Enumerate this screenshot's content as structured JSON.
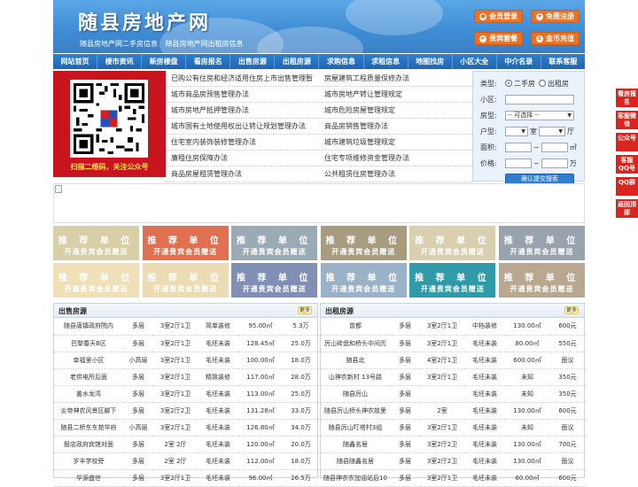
{
  "header": {
    "site_title": "随县房地产网",
    "subtitle_1": "随县房地产网二手房信息",
    "subtitle_2": "随县房地产网出租房信息",
    "buttons": [
      {
        "label": "会员登录",
        "icon": "user-icon"
      },
      {
        "label": "免费注册",
        "icon": "register-icon"
      },
      {
        "label": "贵宾套餐",
        "icon": "vip-icon"
      },
      {
        "label": "金币充值",
        "icon": "coin-icon"
      }
    ]
  },
  "nav": [
    "网站首页",
    "楼市资讯",
    "新房楼盘",
    "看房报名",
    "出售房源",
    "出租房源",
    "求购信息",
    "求租信息",
    "地图找房",
    "小区大全",
    "中介名录",
    "联系客服"
  ],
  "qr": {
    "caption": "扫描二维码，关注公众号"
  },
  "news": [
    [
      "已购公有住房和经济适用住房上市出售管理暂",
      "房屋建筑工程质量保修办法"
    ],
    [
      "城市商品房预售管理办法",
      "城市房地产转让管理规定"
    ],
    [
      "城市房地产抵押管理办法",
      "城市危险房屋管理规定"
    ],
    [
      "城市国有土地使用权出让转让规划管理办法",
      "商品房销售管理办法"
    ],
    [
      "住宅室内装饰装修管理办法",
      "城市建筑垃圾管理规定"
    ],
    [
      "廉租住房保障办法",
      "住宅专项维修资金管理办法"
    ],
    [
      "商品房屋租赁管理办法",
      "公共租赁住房管理办法"
    ]
  ],
  "search": {
    "type_label": "类型:",
    "type_options": [
      "二手房",
      "出租房"
    ],
    "type_selected": "二手房",
    "community_label": "小区:",
    "community_value": "",
    "house_type_label": "房型:",
    "house_type_value": "-- 可选择 --",
    "layout_label": "户型:",
    "room_unit": "室",
    "hall_unit": "厅",
    "area_label": "面积:",
    "area_unit": "㎡",
    "price_label": "价格:",
    "price_unit": "万",
    "range_sep": "~",
    "submit_label": "确认提交搜索"
  },
  "ads": {
    "line1": "推 荐 单 位",
    "line2": "开通贵宾会员赠送",
    "colors": [
      "#d8cfa8",
      "#e07050",
      "#9aabb6",
      "#a89c80",
      "#d9cfb0",
      "#98a3ad",
      "#efe0b8",
      "#ecdcb4",
      "#7f8fb5",
      "#9ab2c8",
      "#2f9aa8",
      "#b8a890"
    ]
  },
  "sale": {
    "title": "出售房源",
    "more": "更多",
    "rows": [
      [
        "随县唐镇政府院内",
        "多层",
        "3室2厅1卫",
        "简单装修",
        "95.00㎡",
        "5.3万"
      ],
      [
        "巴黎春天B区",
        "多层",
        "3室2厅1卫",
        "毛坯未装",
        "128.45㎡",
        "25.0万"
      ],
      [
        "幸福里小区",
        "小高层",
        "3室2厅1卫",
        "毛坯未装",
        "100.00㎡",
        "18.0万"
      ],
      [
        "老供电所后面",
        "多层",
        "3室2厅1卫",
        "精致装修",
        "117.00㎡",
        "28.0万"
      ],
      [
        "姜水龙湾",
        "多层",
        "3室2厅1卫",
        "毛坯未装",
        "113.00㎡",
        "25.0万"
      ],
      [
        "炎帝神农风景区脚下",
        "多层",
        "3室2厅2卫",
        "毛坯未装",
        "131.28㎡",
        "33.0万"
      ],
      [
        "随县二桥东东苑华府",
        "小高层",
        "3室2厅1卫",
        "毛坯未装",
        "126.80㎡",
        "34.0万"
      ],
      [
        "殷店政府宾馆对面",
        "多层",
        "2室 2厅",
        "毛坯未装",
        "120.00㎡",
        "20.0万"
      ],
      [
        "岁丰学校旁",
        "多层",
        "2室 2厅",
        "毛坯未装",
        "112.00㎡",
        "18.0万"
      ],
      [
        "华源盛世",
        "多层",
        "3室2厅1卫",
        "毛坯未装",
        "96.00㎡",
        "26.5万"
      ]
    ]
  },
  "rent": {
    "title": "出租房源",
    "more": "更多",
    "rows": [
      [
        "曾都",
        "多层",
        "3室2厅1卫",
        "中档装修",
        "130.00㎡",
        "600元"
      ],
      [
        "厉山砖盘和桥头中间历",
        "多层",
        "3室2厅1卫",
        "毛坯未装",
        "80.00㎡",
        "550元"
      ],
      [
        "随县北",
        "多层",
        "4室2厅1卫",
        "毛坯未装",
        "600.00㎡",
        "面议"
      ],
      [
        "山神农新村 13号路",
        "多层",
        "3室2厅1卫",
        "毛坯未装",
        "未知",
        "350元"
      ],
      [
        "随县厉山",
        "多层",
        "",
        "毛坯未装",
        "未知",
        "350元"
      ],
      [
        "随县厉山桥头神农故里",
        "多层",
        "2室",
        "毛坯未装",
        "130.00㎡",
        "600元"
      ],
      [
        "随县厉山叮塔村3组",
        "多层",
        "3室2厅1卫",
        "毛坯未装",
        "未知",
        "面议"
      ],
      [
        "随鑫名居",
        "多层",
        "3室2厅2卫",
        "毛坯未装",
        "130.00㎡",
        "700元"
      ],
      [
        "随县随鑫名居",
        "多层",
        "3室2厅2卫",
        "毛坯未装",
        "130.00㎡",
        "面议"
      ],
      [
        "随县神农农加油站后10",
        "多层",
        "3室2厅1卫",
        "毛坯未装",
        "60.00㎡",
        "600元"
      ]
    ]
  },
  "side": [
    "看房报名",
    "客服微信",
    "公众号",
    "客服QQ号",
    "QQ群",
    "返回顶部"
  ]
}
